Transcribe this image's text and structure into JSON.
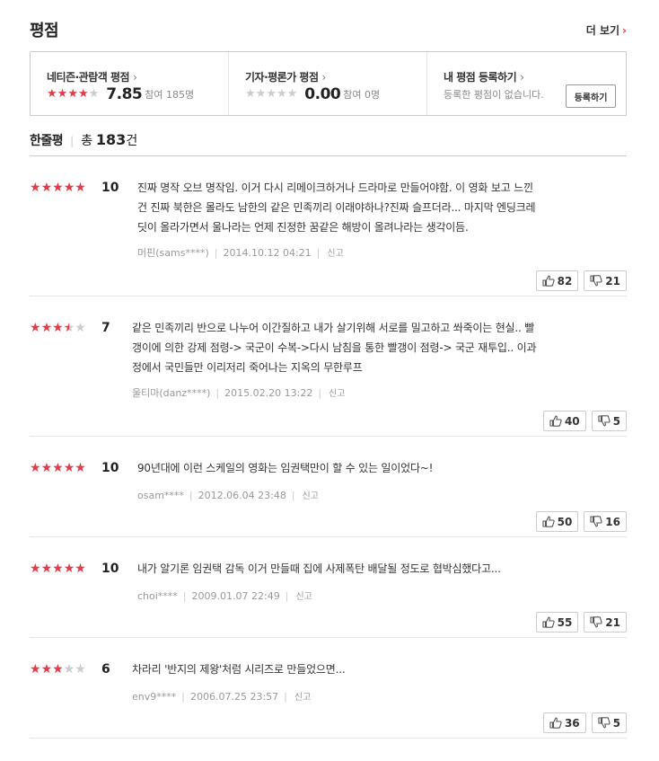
{
  "header": {
    "title": "평점",
    "more_label": "더 보기"
  },
  "summary": {
    "netizen": {
      "label": "네티즌·관람객 평점",
      "score": "7.85",
      "participants": "참여 185명",
      "stars": [
        1,
        1,
        1,
        1,
        0
      ]
    },
    "critic": {
      "label": "기자·평론가 평점",
      "score": "0.00",
      "participants": "참여 0명",
      "stars": [
        0,
        0,
        0,
        0,
        0
      ]
    },
    "mine": {
      "label": "내 평점 등록하기",
      "empty_text": "등록한 평점이 없습니다.",
      "button_label": "등록하기"
    }
  },
  "review_count": {
    "label": "한줄평",
    "prefix": "총",
    "count": "183",
    "suffix": "건"
  },
  "reviews": [
    {
      "stars": [
        1,
        1,
        1,
        1,
        1
      ],
      "score": "10",
      "lines": [
        "진짜 명작 오브 명작임. 이거 다시 리메이크하거나 드라마로 만들어야함. 이 영화 보고 느낀",
        "건 진짜 북한은 몰라도 남한의 같은 민족끼리 이래야하나?진짜 슬프더라... 마지막 엔딩크레",
        "딧이 올라가면서 울나라는 언제 진정한 꿈같은 해방이 올려나라는 생각이듬."
      ],
      "author": "머핀(sams****)",
      "date": "2014.10.12 04:21",
      "report": "신고",
      "likes": "82",
      "dislikes": "21"
    },
    {
      "stars": [
        1,
        1,
        1,
        0.5,
        0
      ],
      "score": "7",
      "lines": [
        "같은 민족끼리 반으로 나누어 이간질하고 내가 살기위해 서로를 밀고하고 쏴죽이는 현실.. 빨",
        "갱이에 의한 강제 점령-> 국군이 수복->다시 남침을 통한 빨갱이 점령-> 국군 재투입.. 이과",
        "정에서 국민들만 이리저리 죽어나는 지옥의 무한루프"
      ],
      "author": "울티마(danz****)",
      "date": "2015.02.20 13:22",
      "report": "신고",
      "likes": "40",
      "dislikes": "5"
    },
    {
      "stars": [
        1,
        1,
        1,
        1,
        1
      ],
      "score": "10",
      "lines": [
        "90년대에 이런 스케일의 영화는 임권택만이 할 수 있는 일이었다~!"
      ],
      "author": "osam****",
      "date": "2012.06.04 23:48",
      "report": "신고",
      "likes": "50",
      "dislikes": "16"
    },
    {
      "stars": [
        1,
        1,
        1,
        1,
        1
      ],
      "score": "10",
      "lines": [
        "내가 알기론 임권택 감독 이거 만들때 집에 사제폭탄 배달될 정도로 협박심했다고..."
      ],
      "author": "choi****",
      "date": "2009.01.07 22:49",
      "report": "신고",
      "likes": "55",
      "dislikes": "21"
    },
    {
      "stars": [
        1,
        1,
        1,
        0,
        0
      ],
      "score": "6",
      "lines": [
        "차라리 '반지의 제왕'처럼 시리즈로 만들었으면..."
      ],
      "author": "env9****",
      "date": "2006.07.25 23:57",
      "report": "신고",
      "likes": "36",
      "dislikes": "5"
    }
  ],
  "colors": {
    "accent": "#e63946",
    "star_off": "#cccccc",
    "border": "#cccccc"
  },
  "icons": {
    "like": "thumbs-up-icon",
    "dislike": "thumbs-down-icon",
    "chevron": "chevron-right-icon"
  }
}
